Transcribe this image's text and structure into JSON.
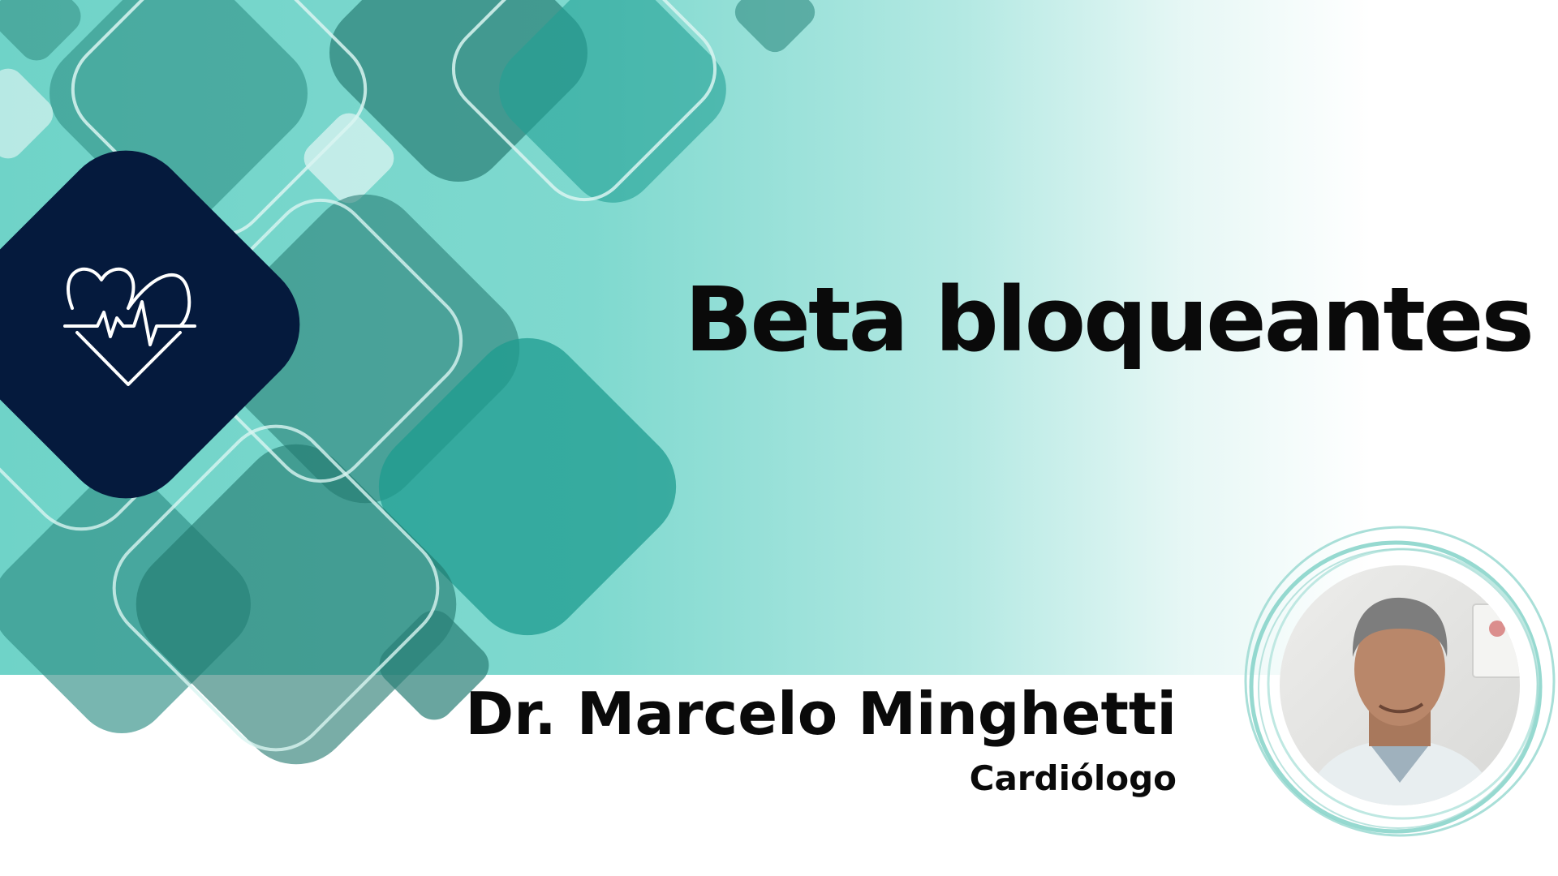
{
  "header": {
    "title": "Beta bloqueantes"
  },
  "author": {
    "name": "Dr. Marcelo Minghetti",
    "role": "Cardiólogo"
  },
  "icons": {
    "badge": "heartbeat-icon"
  },
  "colors": {
    "teal_light": "#7fd9cf",
    "teal_mid": "#3aaba0",
    "teal_dark": "#2f8a80",
    "navy": "#051a3d",
    "text": "#0a0a0a"
  }
}
